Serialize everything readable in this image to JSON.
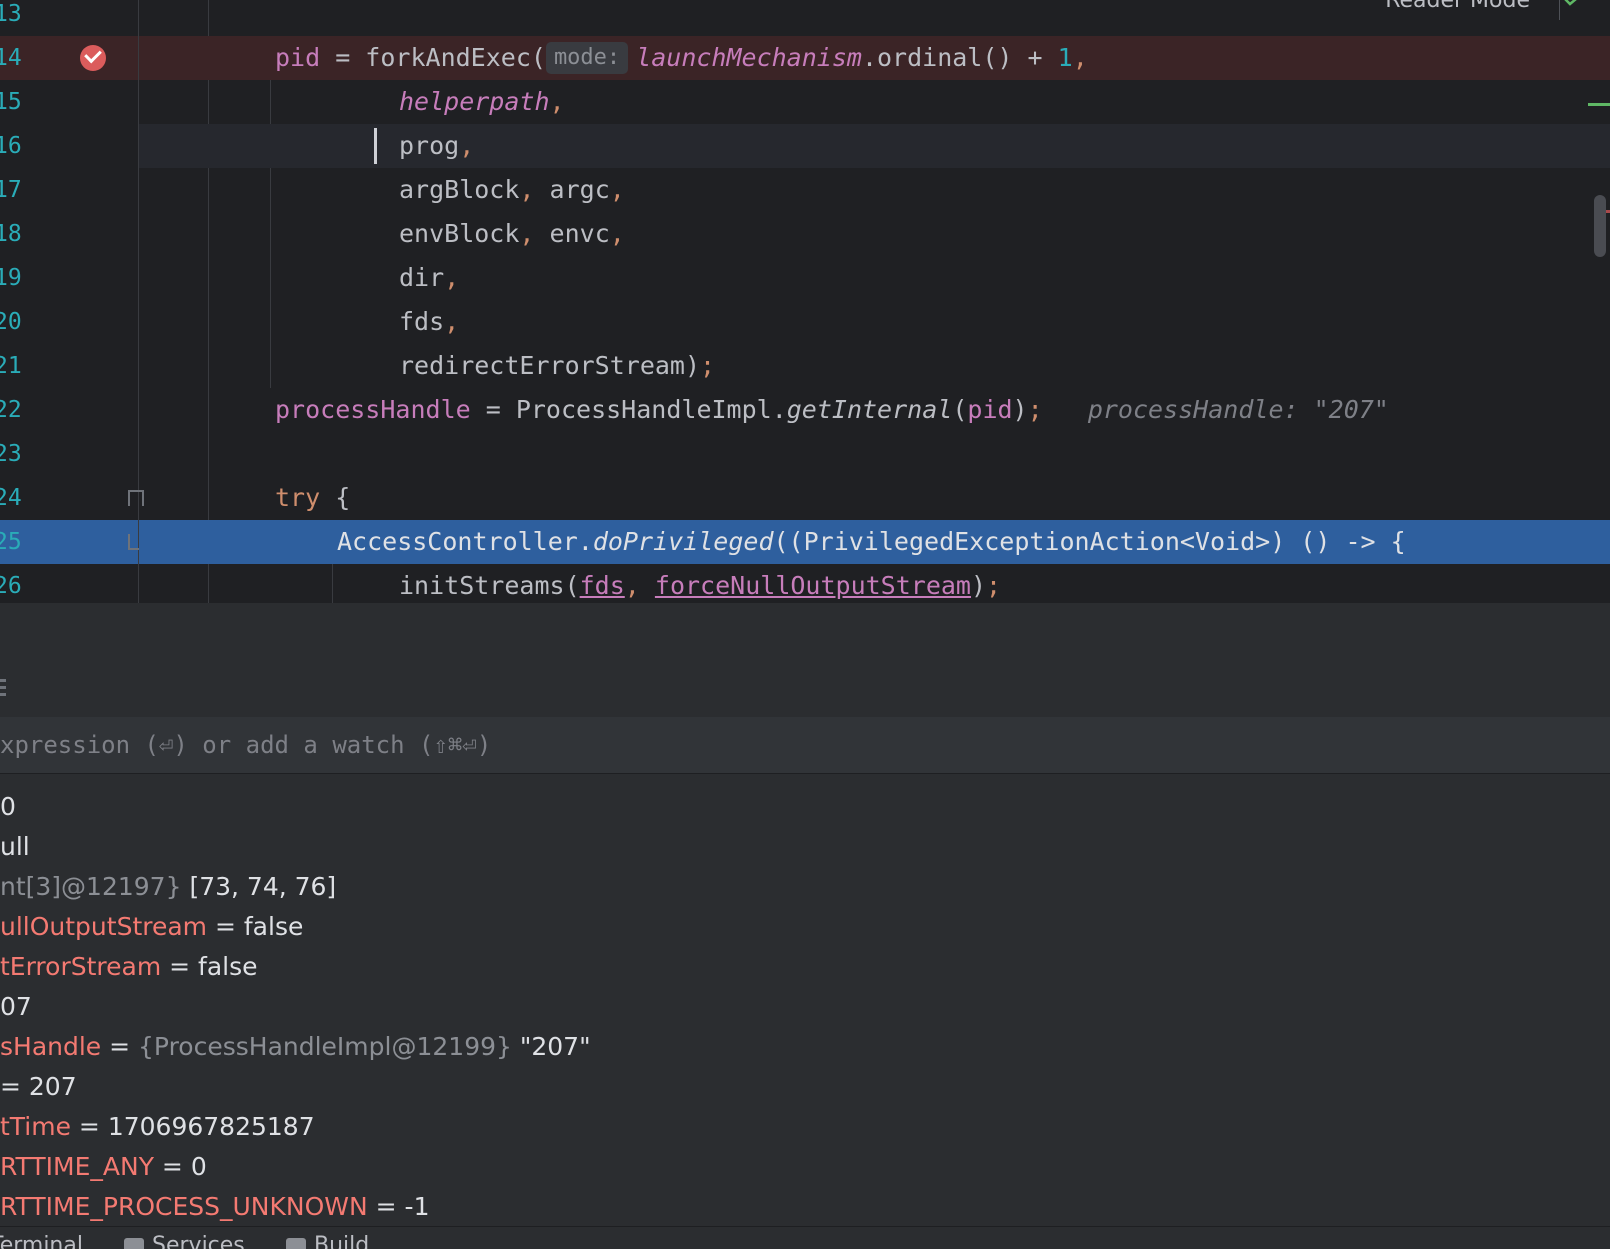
{
  "editor": {
    "reader_mode": "Reader Mode",
    "lines": [
      {
        "num": "13"
      },
      {
        "num": "14"
      },
      {
        "num": "15"
      },
      {
        "num": "16"
      },
      {
        "num": "17"
      },
      {
        "num": "18"
      },
      {
        "num": "19"
      },
      {
        "num": "20"
      },
      {
        "num": "21"
      },
      {
        "num": "22"
      },
      {
        "num": "23"
      },
      {
        "num": "24"
      },
      {
        "num": "25"
      },
      {
        "num": "26"
      }
    ],
    "code": {
      "l14": {
        "a": "pid",
        "b": " = forkAndExec(",
        "hint": "mode:",
        "c": "launchMechanism",
        "d": ".ordinal() + ",
        "e": "1",
        "f": ","
      },
      "l15": {
        "a": "helperpath",
        "b": ","
      },
      "l16": {
        "a": "prog",
        "b": ","
      },
      "l17": {
        "a": "argBlock",
        "b": ",",
        "c": " argc",
        "d": ","
      },
      "l18": {
        "a": "envBlock",
        "b": ",",
        "c": " envc",
        "d": ","
      },
      "l19": {
        "a": "dir",
        "b": ","
      },
      "l20": {
        "a": "fds",
        "b": ","
      },
      "l21": {
        "a": "redirectErrorStream)",
        "b": ";"
      },
      "l22": {
        "a": "processHandle",
        "b": " = ProcessHandleImpl.",
        "c": "getInternal",
        "d": "(",
        "e": "pid",
        "f": ")",
        "g": ";",
        "inline": "processHandle: \"207\""
      },
      "l24": {
        "a": "try",
        "b": " {"
      },
      "l25": {
        "a": "AccessController.",
        "b": "doPrivileged",
        "c": "((PrivilegedExceptionAction<Void>) () -> {"
      },
      "l26": {
        "a": "initStreams(",
        "b": "fds",
        "c": ",",
        "d": " ",
        "e": "forceNullOutputStream",
        "f": ")",
        "g": ";"
      }
    }
  },
  "eval": {
    "placeholder": "xpression (⏎) or add a watch (⇧⌘⏎)"
  },
  "variables": [
    {
      "name": "",
      "sep": "",
      "type": "",
      "value": "0"
    },
    {
      "name": "",
      "sep": "",
      "type": "",
      "value": "ull"
    },
    {
      "name": "",
      "sep": "",
      "type": "nt[3]@12197} ",
      "value": "[73, 74, 76]"
    },
    {
      "name": "ullOutputStream",
      "sep": " = ",
      "type": "",
      "value": "false"
    },
    {
      "name": "tErrorStream",
      "sep": " = ",
      "type": "",
      "value": "false"
    },
    {
      "name": "",
      "sep": "",
      "type": "",
      "value": "07"
    },
    {
      "name": "sHandle",
      "sep": " = ",
      "type": "{ProcessHandleImpl@12199} ",
      "value": "\"207\""
    },
    {
      "name": "",
      "sep": "= ",
      "type": "",
      "value": "207"
    },
    {
      "name": "tTime",
      "sep": " = ",
      "type": "",
      "value": "1706967825187"
    },
    {
      "name": "RTTIME_ANY",
      "sep": " = ",
      "type": "",
      "value": "0"
    },
    {
      "name": "RTTIME_PROCESS_UNKNOWN",
      "sep": " = ",
      "type": "",
      "value": "-1"
    }
  ],
  "bottom_tabs": {
    "terminal": "Terminal",
    "services": "Services",
    "build": "Build"
  },
  "colors": {
    "breakpoint": "#db5c5c",
    "execution_line": "#2e5f9e",
    "variable_name": "#f47a72"
  }
}
